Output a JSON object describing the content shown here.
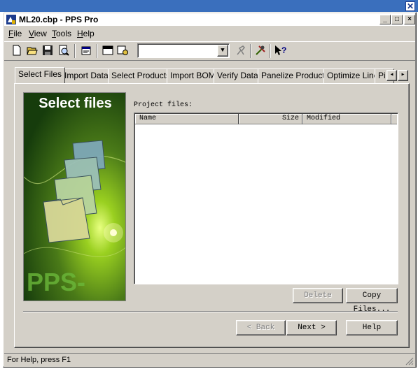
{
  "outer_window": {
    "close_glyph": "✕"
  },
  "window": {
    "title": "ML20.cbp - PPS Pro",
    "app_icon": "pps-app-icon",
    "min_glyph": "_",
    "max_glyph": "□",
    "close_glyph": "×"
  },
  "menu": {
    "items": [
      "File",
      "View",
      "Tools",
      "Help"
    ]
  },
  "toolbar": {
    "icons": [
      "new-file-icon",
      "open-folder-icon",
      "save-icon",
      "print-preview-icon",
      "properties-icon",
      "window-icon",
      "settings-icon",
      "run-icon",
      "tools-icon",
      "context-help-icon"
    ],
    "combo_value": ""
  },
  "tabs": {
    "items": [
      "Select Files",
      "Import Data",
      "Select Products",
      "Import BOM",
      "Verify Data",
      "Panelize Products",
      "Optimize Line",
      "Pi"
    ],
    "active": "Select Files",
    "scroll_left": "◂",
    "scroll_right": "▸"
  },
  "banner": {
    "title": "Select files",
    "brand": "PPS-Pro"
  },
  "project_files": {
    "label": "Project files:",
    "columns": [
      "Name",
      "Size",
      "Modified"
    ],
    "rows": []
  },
  "buttons": {
    "delete": "Delete",
    "copy_files": "Copy Files...",
    "back": "< Back",
    "next": "Next >",
    "help": "Help"
  },
  "status_bar": {
    "text": "For Help, press F1"
  },
  "colors": {
    "title_bar": "#1c3b8c",
    "face": "#d4d0c8",
    "outer_frame": "#3a6fbd",
    "banner_green": "#4a7a18"
  }
}
